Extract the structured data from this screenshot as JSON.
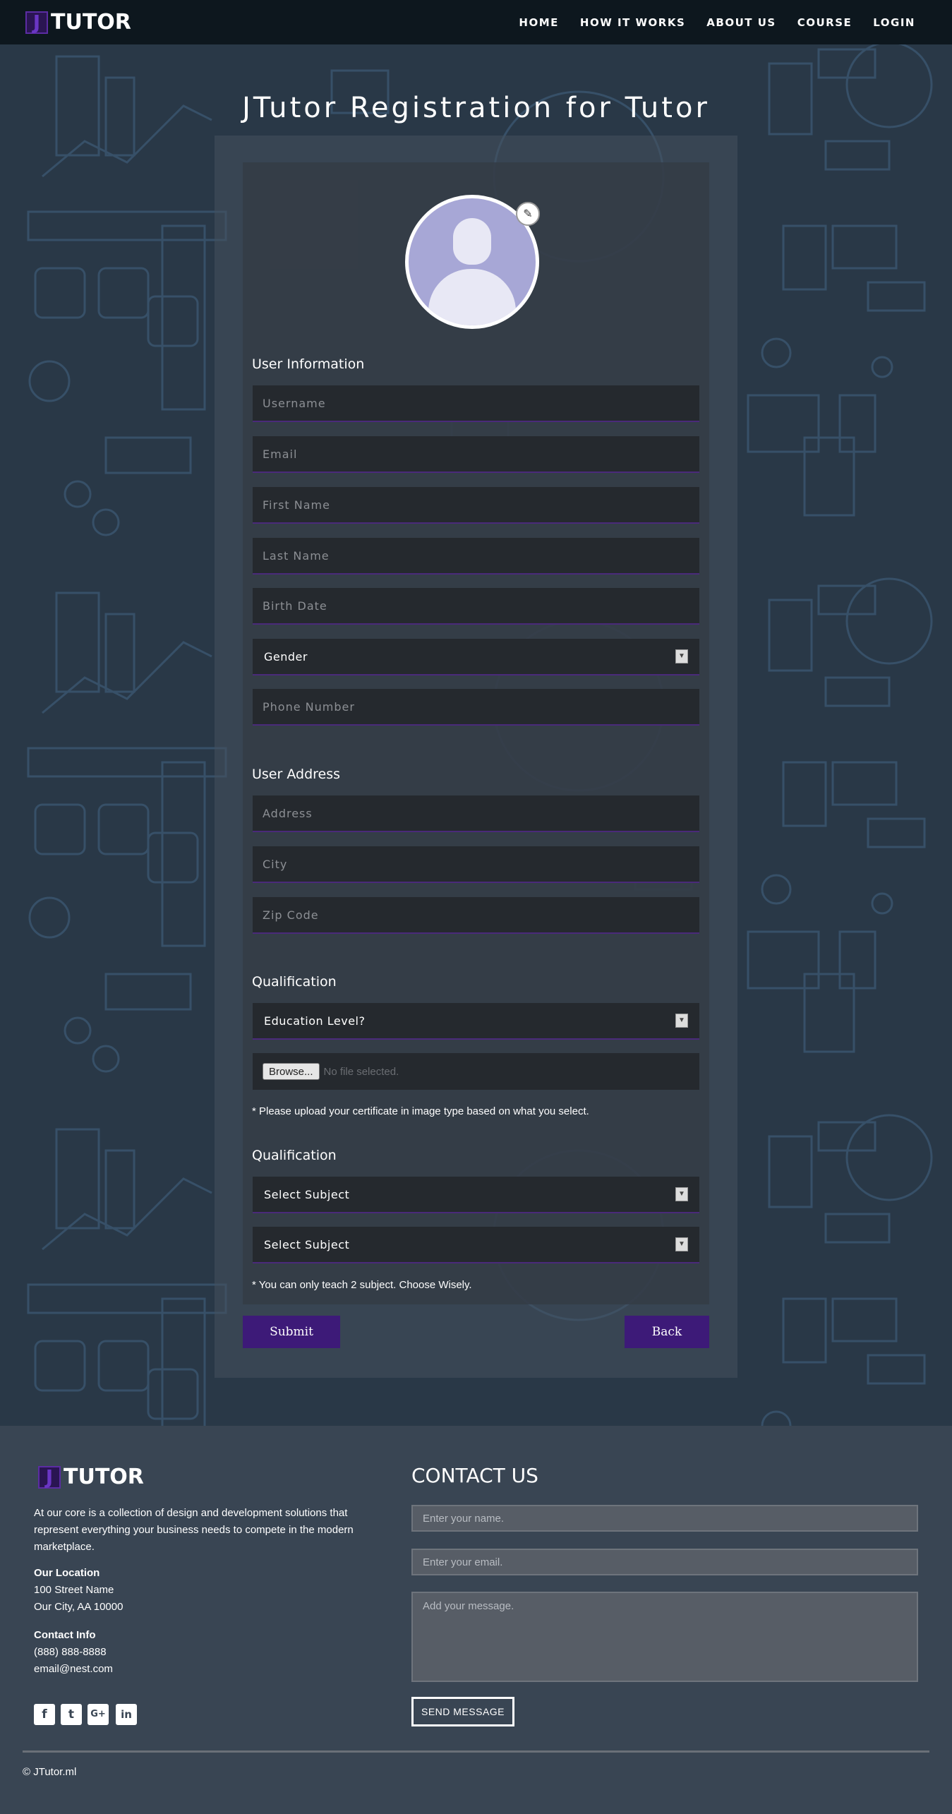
{
  "brand": {
    "logo_letter": "J",
    "logo_text": "TUTOR"
  },
  "nav": {
    "items": [
      {
        "label": "HOME"
      },
      {
        "label": "HOW IT WORKS"
      },
      {
        "label": "ABOUT US"
      },
      {
        "label": "COURSE"
      },
      {
        "label": "LOGIN"
      }
    ]
  },
  "page_title": "JTutor Registration for Tutor",
  "avatar": {
    "icon": "user-silhouette-icon",
    "edit_icon": "pencil-icon"
  },
  "user_info": {
    "title": "User Information",
    "username_placeholder": "Username",
    "email_placeholder": "Email",
    "first_name_placeholder": "First Name",
    "last_name_placeholder": "Last Name",
    "birth_date_placeholder": "Birth Date",
    "gender_label": "Gender",
    "phone_placeholder": "Phone Number"
  },
  "user_address": {
    "title": "User Address",
    "address_placeholder": "Address",
    "city_placeholder": "City",
    "zip_placeholder": "Zip Code"
  },
  "qualification": {
    "title": "Qualification",
    "education_label": "Education Level?",
    "browse_label": "Browse...",
    "no_file_text": "No file selected.",
    "note": "* Please upload your certificate in image type based on what you select."
  },
  "subjects": {
    "title": "Qualification",
    "subject1_label": "Select Subject",
    "subject2_label": "Select Subject",
    "note": "* You can only teach 2 subject. Choose Wisely."
  },
  "actions": {
    "submit": "Submit",
    "back": "Back"
  },
  "footer": {
    "logo_letter": "J",
    "logo_text": "TUTOR",
    "description": "At our core is a collection of design and development solutions that represent everything your business needs to compete in the modern marketplace.",
    "location_title": "Our Location",
    "location_line1": "100 Street Name",
    "location_line2": "Our City, AA 10000",
    "contact_title": "Contact Info",
    "phone": "(888) 888-8888",
    "email": "email@nest.com",
    "social": [
      {
        "icon": "facebook-icon",
        "glyph": "f"
      },
      {
        "icon": "twitter-icon",
        "glyph": "t"
      },
      {
        "icon": "google-plus-icon",
        "glyph": "G+"
      },
      {
        "icon": "linkedin-icon",
        "glyph": "in"
      }
    ],
    "copyright": "© JTutor.ml"
  },
  "contact_form": {
    "title": "CONTACT US",
    "name_placeholder": "Enter your name.",
    "email_placeholder": "Enter your email.",
    "message_placeholder": "Add your message.",
    "send_label": "SEND MESSAGE"
  },
  "colors": {
    "accent": "#3d1a78",
    "navbar": "#0d171e",
    "footer": "#394553"
  }
}
